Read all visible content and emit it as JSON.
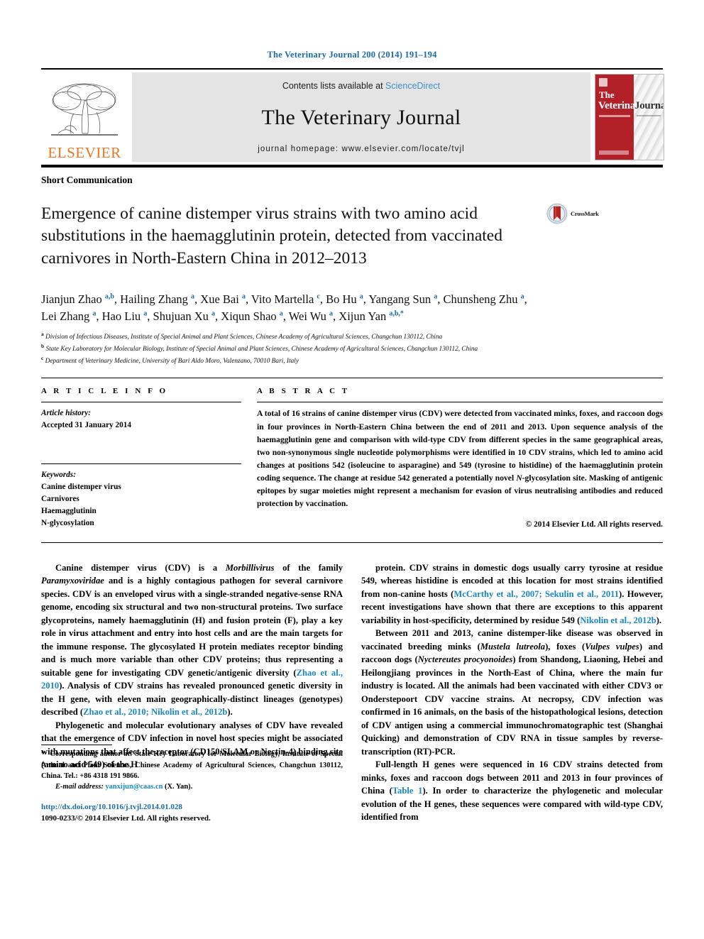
{
  "running_head": "The Veterinary Journal 200 (2014) 191–194",
  "masthead": {
    "publisher_logo_text": "ELSEVIER",
    "contents_prefix": "Contents lists available at ",
    "contents_link": "ScienceDirect",
    "journal_name": "The Veterinary Journal",
    "homepage": "journal homepage: www.elsevier.com/locate/tvjl",
    "cover": {
      "line_the": "The",
      "line_veterinary": "Veterinary",
      "line_journal": "Journal"
    }
  },
  "article": {
    "type": "Short Communication",
    "title": "Emergence of canine distemper virus strains with two amino acid substitutions in the haemagglutinin protein, detected from vaccinated carnivores in North-Eastern China in 2012–2013",
    "crossmark_label": "CrossMark"
  },
  "authors": {
    "line1": "Jianjun Zhao <sup>a,b</sup>, Hailing Zhang <sup>a</sup>, Xue Bai <sup>a</sup>, Vito Martella <sup>c</sup>, Bo Hu <sup>a</sup>, Yangang Sun <sup>a</sup>, Chunsheng Zhu <sup>a</sup>,",
    "line2": "Lei Zhang <sup>a</sup>, Hao Liu <sup>a</sup>, Shujuan Xu <sup>a</sup>, Xiqun Shao <sup>a</sup>, Wei Wu <sup>a</sup>, Xijun Yan <sup>a,b,</sup><sup>*</sup>"
  },
  "affiliations": [
    "<sup>a</sup> Division of Infectious Diseases, Institute of Special Animal and Plant Sciences, Chinese Academy of Agricultural Sciences, Changchun 130112, China",
    "<sup>b</sup> State Key Laboratory for Molecular Biology, Institute of Special Animal and Plant Sciences, Chinese Academy of Agricultural Sciences, Changchun 130112, China",
    "<sup>c</sup> Department of Veterinary Medicine, University of Bari Aldo Moro, Valenzano, 70010 Bari, Italy"
  ],
  "article_info": {
    "heading": "A R T I C L E    I N F O",
    "history_label": "Article history:",
    "history_value": "Accepted 31 January 2014",
    "keywords_label": "Keywords:",
    "keywords": [
      "Canine distemper virus",
      "Carnivores",
      "Haemagglutinin",
      "N-glycosylation"
    ]
  },
  "abstract": {
    "heading": "A B S T R A C T",
    "text": "A total of 16 strains of canine distemper virus (CDV) were detected from vaccinated minks, foxes, and raccoon dogs in four provinces in North-Eastern China between the end of 2011 and 2013. Upon sequence analysis of the haemagglutinin gene and comparison with wild-type CDV from different species in the same geographical areas, two non-synonymous single nucleotide polymorphisms were identified in 10 CDV strains, which led to amino acid changes at positions 542 (isoleucine to asparagine) and 549 (tyrosine to histidine) of the haemagglutinin protein coding sequence. The change at residue 542 generated a potentially novel <em>N</em>-glycosylation site. Masking of antigenic epitopes by sugar moieties might represent a mechanism for evasion of virus neutralising antibodies and reduced protection by vaccination.",
    "copyright": "© 2014 Elsevier Ltd. All rights reserved."
  },
  "body": {
    "left_column": [
      "Canine distemper virus (CDV) is a <em>Morbillivirus</em> of the family <em>Paramyxoviridae</em> and is a highly contagious pathogen for several carnivore species. CDV is an enveloped virus with a single-stranded negative-sense RNA genome, encoding six structural and two non-structural proteins. Two surface glycoproteins, namely haemagglutinin (H) and fusion protein (F), play a key role in virus attachment and entry into host cells and are the main targets for the immune response. The glycosylated H protein mediates receptor binding and is much more variable than other CDV proteins; thus representing a suitable gene for investigating CDV genetic/antigenic diversity (<span class=\"ref\">Zhao et al., 2010</span>). Analysis of CDV strains has revealed pronounced genetic diversity in the H gene, with eleven main geographically-distinct lineages (genotypes) described (<span class=\"ref\">Zhao et al., 2010; Nikolin et al., 2012b</span>).",
      "Phylogenetic and molecular evolutionary analyses of CDV have revealed that the emergence of CDV infection in novel host species might be associated with mutations that affect the receptor (CD150/SLAM or Nectin-4) binding site (amino acid 549) of the H"
    ],
    "right_column": [
      "protein. CDV strains in domestic dogs usually carry tyrosine at residue 549, whereas histidine is encoded at this location for most strains identified from non-canine hosts (<span class=\"ref\">McCarthy et al., 2007; Sekulin et al., 2011</span>). However, recent investigations have shown that there are exceptions to this apparent variability in host-specificity, determined by residue 549 (<span class=\"ref\">Nikolin et al., 2012b</span>).",
      "Between 2011 and 2013, canine distemper-like disease was observed in vaccinated breeding minks (<em>Mustela lutreola</em>), foxes (<em>Vulpes vulpes</em>) and raccoon dogs (<em>Nyctereutes procyonoides</em>) from Shandong, Liaoning, Hebei and Heilongjiang provinces in the North-East of China, where the main fur industry is located. All the animals had been vaccinated with either CDV3 or Onderstepoort CDV vaccine strains. At necropsy, CDV infection was confirmed in 16 animals, on the basis of the histopathological lesions, detection of CDV antigen using a commercial immunochromatographic test (Shanghai Quicking) and demonstration of CDV RNA in tissue samples by reverse-transcription (RT)-PCR.",
      "Full-length H genes were sequenced in 16 CDV strains detected from minks, foxes and raccoon dogs between 2011 and 2013 in four provinces of China (<span class=\"ref\">Table 1</span>). In order to characterize the phylogenetic and molecular evolution of the H genes, these sequences were compared with wild-type CDV, identified from"
    ]
  },
  "footnote": {
    "corresponding": "<span class=\"star\">*</span>&nbsp; Corresponding author at: State Key Laboratory for Molecular Biology, Institute of Special Animal and Plant Sciences, Chinese Academy of Agricultural Sciences, Changchun 130112, China. Tel.: +86 4318 191 9866.",
    "email_label": "E-mail address:",
    "email": "yanxijun@caas.cn",
    "email_suffix": "(X. Yan).",
    "doi": "http://dx.doi.org/10.1016/j.tvjl.2014.01.028",
    "issn": "1090-0233/© 2014 Elsevier Ltd. All rights reserved."
  },
  "colors": {
    "link_blue": "#1a87c4",
    "head_blue": "#1a6ca8",
    "elsevier_orange": "#E87722",
    "cover_red": "#b22028"
  }
}
